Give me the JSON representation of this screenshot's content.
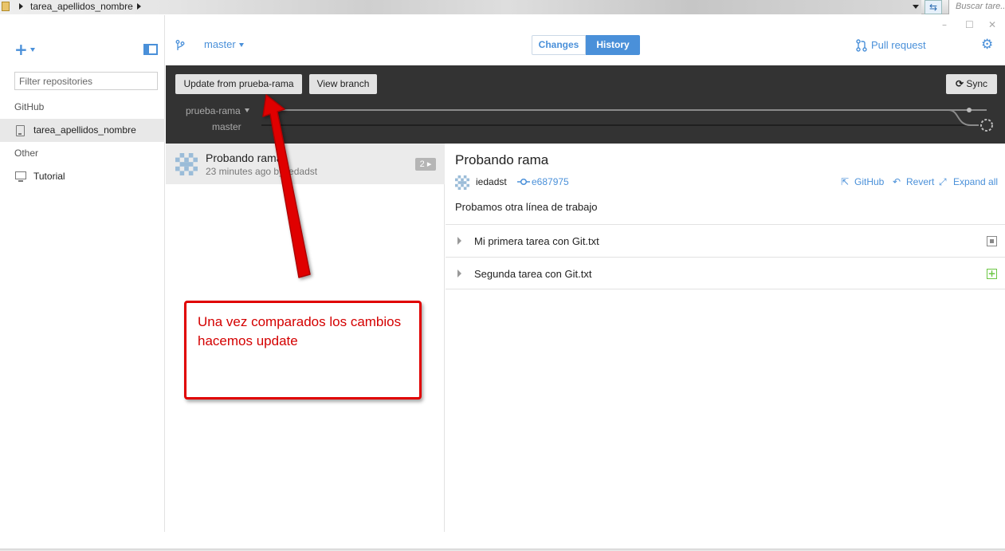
{
  "explorer": {
    "path": "tarea_apellidos_nombre",
    "search_placeholder": "Buscar tare..."
  },
  "sidebar": {
    "filter_placeholder": "Filter repositories",
    "sections": [
      {
        "heading": "GitHub",
        "items": [
          {
            "label": "tarea_apellidos_nombre",
            "selected": true,
            "icon": "repo-icon"
          }
        ]
      },
      {
        "heading": "Other",
        "items": [
          {
            "label": "Tutorial",
            "selected": false,
            "icon": "monitor-icon"
          }
        ]
      }
    ]
  },
  "toolbar": {
    "branch": "master",
    "tabs": [
      {
        "label": "Changes",
        "active": false
      },
      {
        "label": "History",
        "active": true
      }
    ],
    "pull_request_label": "Pull request"
  },
  "compare_bar": {
    "update_button": "Update from prueba-rama",
    "view_branch_button": "View branch",
    "sync_button": "Sync",
    "compare_branch": "prueba-rama",
    "base_branch": "master"
  },
  "commit_list": [
    {
      "title": "Probando rama",
      "meta": "23 minutes ago by iedadst",
      "file_count": "2"
    }
  ],
  "commit_detail": {
    "title": "Probando rama",
    "author": "iedadst",
    "sha": "e687975",
    "links": {
      "github": "GitHub",
      "revert": "Revert",
      "expand_all": "Expand all"
    },
    "description": "Probamos otra línea de trabajo",
    "files": [
      {
        "name": "Mi primera tarea con Git.txt",
        "status": "modified"
      },
      {
        "name": "Segunda tarea con Git.txt",
        "status": "added"
      }
    ]
  },
  "annotation": {
    "text": "Una vez comparados los cambios hacemos update"
  },
  "colors": {
    "accent": "#4a90d9",
    "dark_bar": "#333333",
    "annotation_red": "#e00000",
    "added_green": "#6cc644"
  }
}
